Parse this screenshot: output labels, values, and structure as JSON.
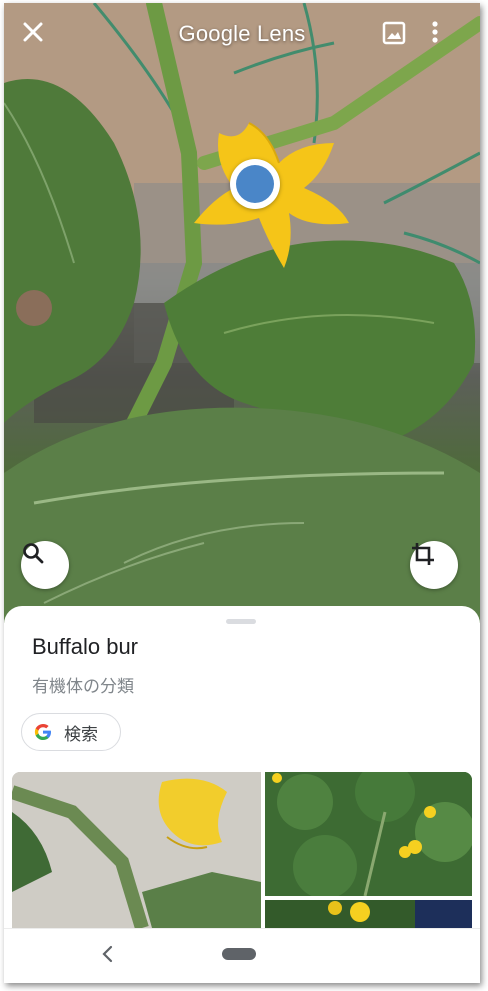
{
  "app": {
    "title": "Google Lens"
  },
  "toolbar": {
    "close_icon": "close-icon",
    "gallery_icon": "image-icon",
    "more_icon": "more-vert-icon"
  },
  "camera": {
    "search_icon": "search-icon",
    "crop_icon": "crop-icon"
  },
  "result": {
    "title": "Buffalo bur",
    "subtitle": "有機体の分類",
    "search_chip_label": "検索",
    "search_chip_icon": "google-g-icon",
    "images": [
      {
        "alt": "buffalo-bur-photo-1"
      },
      {
        "alt": "buffalo-bur-photo-2"
      },
      {
        "alt": "buffalo-bur-photo-3"
      }
    ]
  },
  "navbar": {
    "back_icon": "back-icon",
    "home_icon": "home-pill-icon"
  },
  "colors": {
    "accent_blue": "#4a86c8",
    "flower_yellow": "#f5c518",
    "leaf_green": "#5a7f45"
  }
}
